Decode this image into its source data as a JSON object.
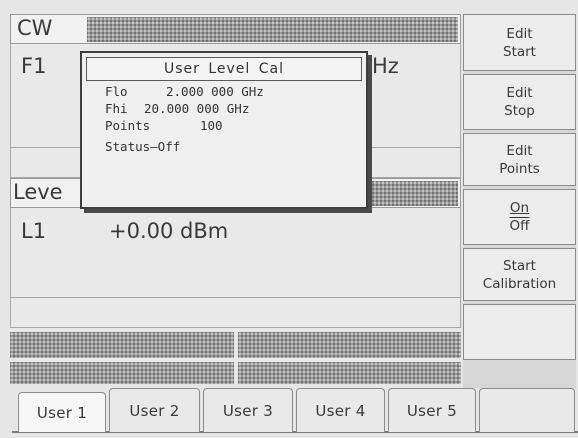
{
  "mode_label": "CW",
  "freq": {
    "label": "F1",
    "unit": "Hz"
  },
  "level": {
    "label": "Leve",
    "channel": "L1",
    "value": "+0.00 dBm"
  },
  "dialog": {
    "title": "User Level Cal",
    "flo_label": "Flo",
    "flo_value": "2.000 000 GHz",
    "fhi_label": "Fhi",
    "fhi_value": "20.000 000 GHz",
    "points_label": "Points",
    "points_value": "100",
    "status": "Status–Off"
  },
  "softkeys": [
    {
      "line1": "Edit",
      "line2": "Start"
    },
    {
      "line1": "Edit",
      "line2": "Stop"
    },
    {
      "line1": "Edit",
      "line2": "Points"
    },
    {
      "line1": "On",
      "line2": "Off"
    },
    {
      "line1": "Start",
      "line2": "Calibration"
    },
    {
      "line1": "",
      "line2": ""
    }
  ],
  "tabs": [
    "User 1",
    "User 2",
    "User 3",
    "User 4",
    "User 5",
    ""
  ],
  "active_tab": "User 1"
}
